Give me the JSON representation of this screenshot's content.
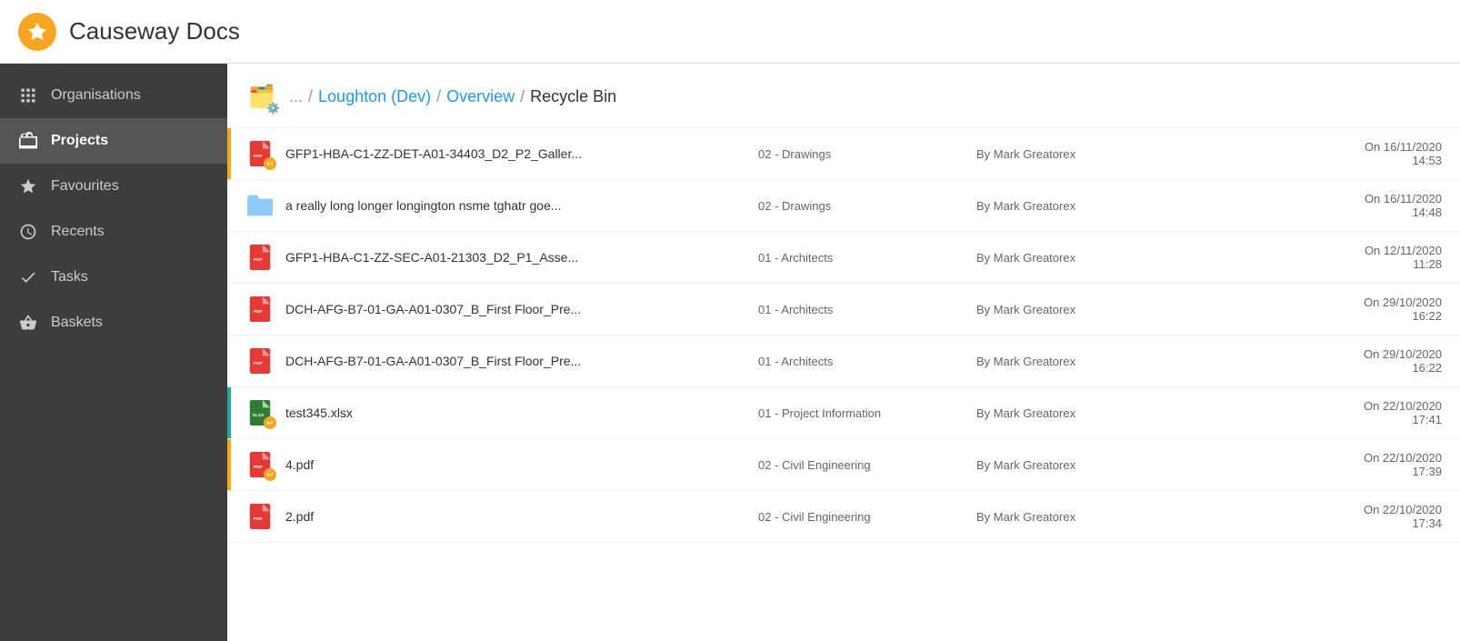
{
  "app": {
    "title": "Causeway Docs"
  },
  "sidebar": {
    "items": [
      {
        "id": "organisations",
        "label": "Organisations",
        "icon": "grid-icon",
        "active": false
      },
      {
        "id": "projects",
        "label": "Projects",
        "icon": "briefcase-icon",
        "active": true
      },
      {
        "id": "favourites",
        "label": "Favourites",
        "icon": "star-icon",
        "active": false
      },
      {
        "id": "recents",
        "label": "Recents",
        "icon": "clock-icon",
        "active": false
      },
      {
        "id": "tasks",
        "label": "Tasks",
        "icon": "check-icon",
        "active": false
      },
      {
        "id": "baskets",
        "label": "Baskets",
        "icon": "basket-icon",
        "active": false
      }
    ]
  },
  "breadcrumb": {
    "ellipsis": "...",
    "project": "Loughton (Dev)",
    "section": "Overview",
    "current": "Recycle Bin"
  },
  "files": [
    {
      "id": 1,
      "name": "GFP1-HBA-C1-ZZ-DET-A01-34403_D2_P2_Galler...",
      "category": "02 - Drawings",
      "by": "By Mark Greatorex",
      "date": "On 16/11/2020\n14:53",
      "type": "pdf",
      "bar": "orange"
    },
    {
      "id": 2,
      "name": "a really long longer longington nsme tghatr goe...",
      "category": "02 - Drawings",
      "by": "By Mark Greatorex",
      "date": "On 16/11/2020\n14:48",
      "type": "folder",
      "bar": "none"
    },
    {
      "id": 3,
      "name": "GFP1-HBA-C1-ZZ-SEC-A01-21303_D2_P1_Asse...",
      "category": "01 - Architects",
      "by": "By Mark Greatorex",
      "date": "On 12/11/2020\n11:28",
      "type": "pdf",
      "bar": "none"
    },
    {
      "id": 4,
      "name": "DCH-AFG-B7-01-GA-A01-0307_B_First Floor_Pre...",
      "category": "01 - Architects",
      "by": "By Mark Greatorex",
      "date": "On 29/10/2020\n16:22",
      "type": "pdf",
      "bar": "none"
    },
    {
      "id": 5,
      "name": "DCH-AFG-B7-01-GA-A01-0307_B_First Floor_Pre...",
      "category": "01 - Architects",
      "by": "By Mark Greatorex",
      "date": "On 29/10/2020\n16:22",
      "type": "pdf",
      "bar": "none"
    },
    {
      "id": 6,
      "name": "test345.xlsx",
      "category": "01 - Project Information",
      "by": "By Mark Greatorex",
      "date": "On 22/10/2020\n17:41",
      "type": "xlsx",
      "bar": "teal"
    },
    {
      "id": 7,
      "name": "4.pdf",
      "category": "02 - Civil Engineering",
      "by": "By Mark Greatorex",
      "date": "On 22/10/2020\n17:39",
      "type": "pdf",
      "bar": "orange"
    },
    {
      "id": 8,
      "name": "2.pdf",
      "category": "02 - Civil Engineering",
      "by": "By Mark Greatorex",
      "date": "On 22/10/2020\n17:34",
      "type": "pdf",
      "bar": "none"
    }
  ]
}
